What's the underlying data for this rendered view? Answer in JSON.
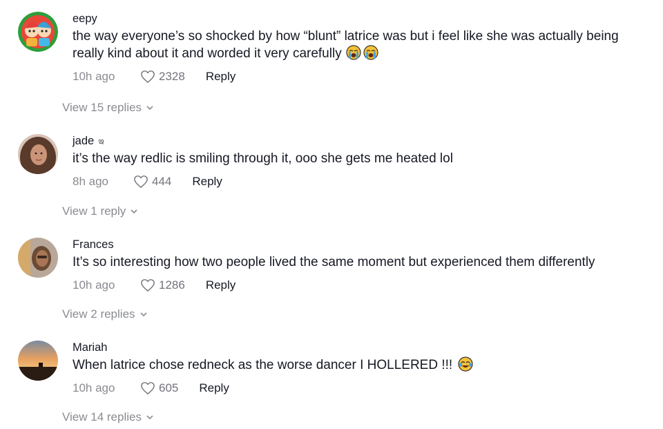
{
  "comments": [
    {
      "username": "eepy",
      "text": "the way everyone’s so shocked by how “blunt” latrice was but i feel like she was actually being really kind about it and worded it very carefully",
      "time": "10h ago",
      "likes": "2328",
      "reply_label": "Reply",
      "view_replies": "View 15 replies",
      "trailing_emoji": [
        "loudly-crying-face",
        "loudly-crying-face"
      ]
    },
    {
      "username": "jade",
      "username_suffix": "ఇ",
      "text": "it’s the way redlic is smiling through it, ooo she gets me heated lol",
      "time": "8h ago",
      "likes": "444",
      "reply_label": "Reply",
      "view_replies": "View 1 reply"
    },
    {
      "username": "Frances",
      "text": "It’s so interesting how two people lived the same moment but experienced them differently",
      "time": "10h ago",
      "likes": "1286",
      "reply_label": "Reply",
      "view_replies": "View 2 replies"
    },
    {
      "username": "Mariah",
      "text": "When latrice chose redneck as the worse dancer I HOLLERED !!!",
      "time": "10h ago",
      "likes": "605",
      "reply_label": "Reply",
      "view_replies": "View 14 replies",
      "trailing_emoji": [
        "face-with-tears-of-joy"
      ]
    }
  ],
  "colors": {
    "text": "#161823",
    "muted": "#8a8b91",
    "emoji_yellow": "#f6c134",
    "tear_blue": "#4aa3df"
  }
}
